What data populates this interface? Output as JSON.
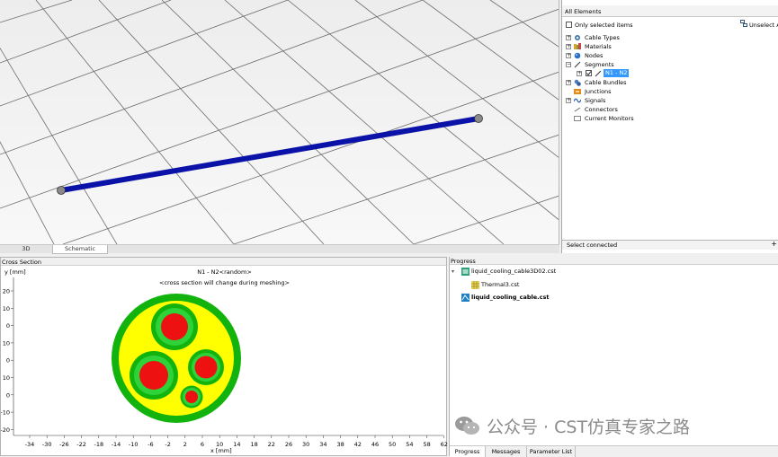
{
  "view3d": {
    "tabs": [
      {
        "label": "3D"
      },
      {
        "label": "Schematic"
      }
    ]
  },
  "tree": {
    "header": "All Elements",
    "only_selected_label": "Only selected items",
    "unselect_label": "Unselect A",
    "items": [
      {
        "label": "Cable Types",
        "icon": "cable-types-icon"
      },
      {
        "label": "Materials",
        "icon": "materials-icon"
      },
      {
        "label": "Nodes",
        "icon": "nodes-icon"
      },
      {
        "label": "Segments",
        "icon": "segments-icon"
      },
      {
        "label": "N1 - N2",
        "icon": "segment-line-icon"
      },
      {
        "label": "Cable Bundles",
        "icon": "cable-bundles-icon"
      },
      {
        "label": "Junctions",
        "icon": "junctions-icon"
      },
      {
        "label": "Signals",
        "icon": "signals-icon"
      },
      {
        "label": "Connectors",
        "icon": "connectors-icon"
      },
      {
        "label": "Current Monitors",
        "icon": "current-monitors-icon"
      }
    ],
    "footer": "Select connected"
  },
  "cross_section": {
    "panel_title": "Cross Section",
    "title": "N1 - N2<random>",
    "subtitle": "<cross section will change during meshing>",
    "ylabel": "y [mm]",
    "xlabel": "x [mm]",
    "x_ticks": [
      "-34",
      "-30",
      "-26",
      "-22",
      "-18",
      "-14",
      "-10",
      "-6",
      "-2",
      "2",
      "6",
      "10",
      "14",
      "18",
      "22",
      "26",
      "30",
      "34",
      "38",
      "42",
      "46",
      "50",
      "54",
      "58",
      "62"
    ],
    "y_ticks": [
      "20",
      "10",
      "0",
      "10",
      "0",
      "10",
      "0",
      "-10",
      "-20"
    ],
    "colors": {
      "jacket": "#12b30c",
      "filler": "#ffff00",
      "conductor": "#ee1111",
      "insulation": "#2ed33a"
    }
  },
  "progress": {
    "panel_title": "Progress",
    "items": [
      {
        "label": "liquid_cooling_cable3D02.cst",
        "bold": false
      },
      {
        "label": "Thermal3.cst",
        "bold": false
      },
      {
        "label": "liquid_cooling_cable.cst",
        "bold": true
      }
    ],
    "tabs": [
      {
        "label": "Progress"
      },
      {
        "label": "Messages"
      },
      {
        "label": "Parameter List"
      }
    ]
  },
  "watermark": "公众号 · CST仿真专家之路"
}
